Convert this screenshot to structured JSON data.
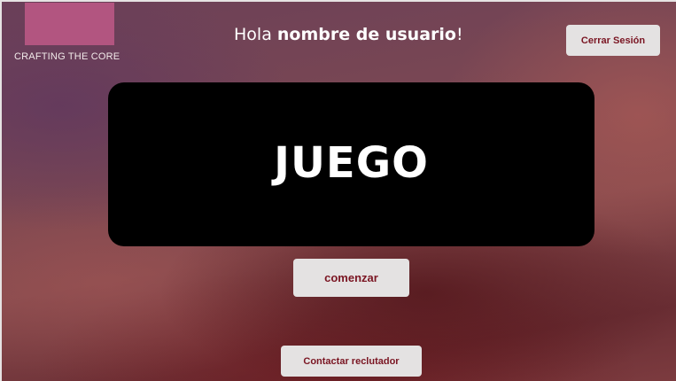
{
  "brand": {
    "name": "CRAFTING THE CORE",
    "logo_color": "#b25580"
  },
  "header": {
    "greeting_prefix": "Hola ",
    "username": "nombre de usuario",
    "greeting_suffix": "!",
    "logout_label": "Cerrar Sesión"
  },
  "game": {
    "title": "JUEGO",
    "start_label": "comenzar"
  },
  "footer": {
    "contact_label": "Contactar reclutador"
  },
  "colors": {
    "button_background": "#e4e2e2",
    "button_text": "#7a1522",
    "panel_background": "#000000"
  }
}
